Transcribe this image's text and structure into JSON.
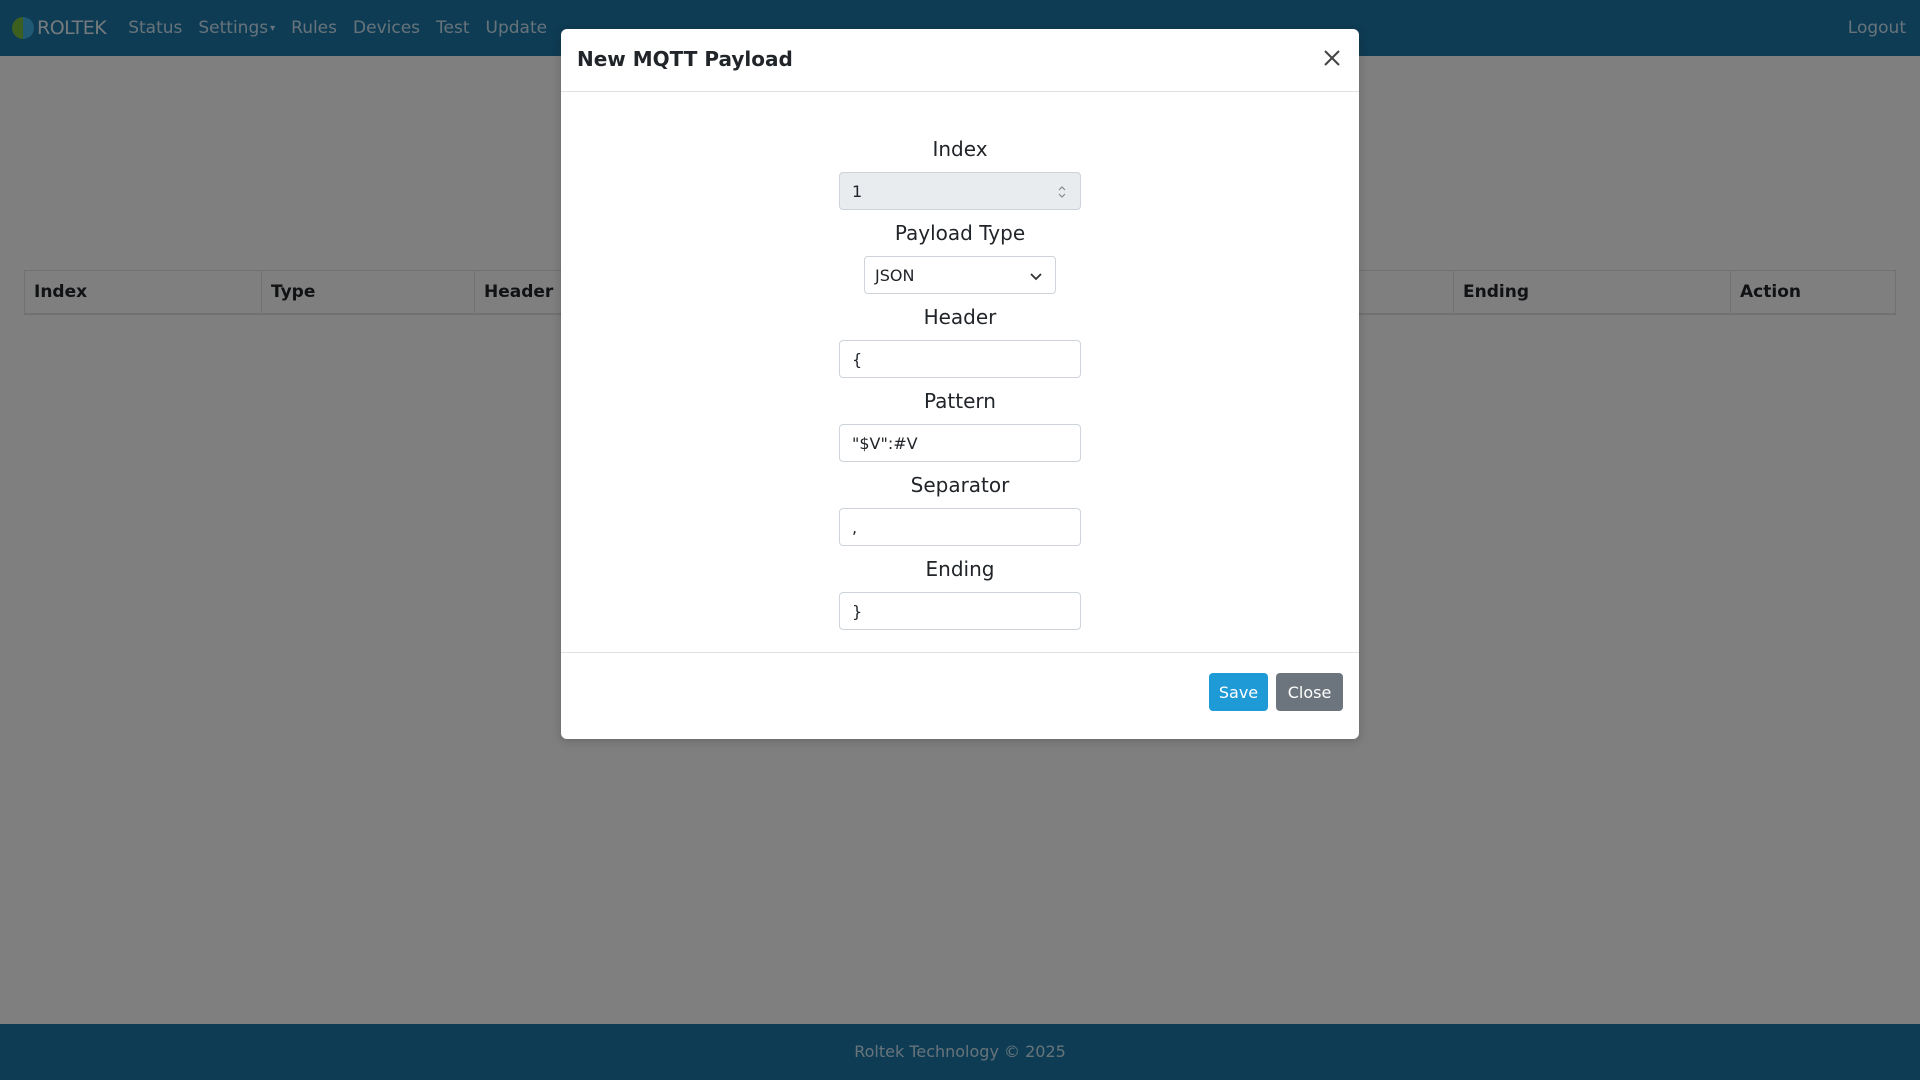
{
  "navbar": {
    "brand": "ROLTEK",
    "links": [
      "Status",
      "Settings",
      "Rules",
      "Devices",
      "Test",
      "Update"
    ],
    "logout": "Logout"
  },
  "table": {
    "headers": [
      "Index",
      "Type",
      "Header",
      "Ending",
      "Action"
    ]
  },
  "footer": {
    "text": "Roltek Technology © 2025"
  },
  "modal": {
    "title": "New MQTT Payload",
    "fields": {
      "index": {
        "label": "Index",
        "value": "1"
      },
      "payload_type": {
        "label": "Payload Type",
        "value": "JSON"
      },
      "header": {
        "label": "Header",
        "value": "{"
      },
      "pattern": {
        "label": "Pattern",
        "value": "\"$V\":#V"
      },
      "separator": {
        "label": "Separator",
        "value": ","
      },
      "ending": {
        "label": "Ending",
        "value": "}"
      }
    },
    "save_label": "Save",
    "close_label": "Close"
  },
  "colors": {
    "navbar": "#1d78a8",
    "save_button": "#1e9ad6",
    "close_button": "#6c757d"
  }
}
